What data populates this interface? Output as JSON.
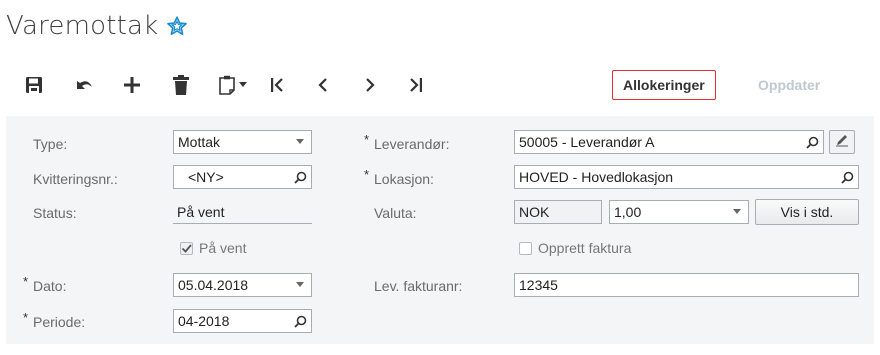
{
  "page": {
    "title": "Varemottak",
    "favorite_icon": "star-outline-icon",
    "accent": "#1a8ad4"
  },
  "toolbar": {
    "icons": [
      "save-icon",
      "undo-icon",
      "add-icon",
      "delete-icon",
      "paste-icon",
      "dropdown-caret-icon",
      "first-icon",
      "previous-icon",
      "next-icon",
      "last-icon"
    ],
    "allokeringer_label": "Allokeringer",
    "oppdater_label": "Oppdater",
    "highlight_color": "#e3312e"
  },
  "form": {
    "type": {
      "label": "Type:",
      "value": "Mottak"
    },
    "kvittering": {
      "label": "Kvitteringsnr.:",
      "value": "<NY>"
    },
    "status": {
      "label": "Status:",
      "value": "På vent"
    },
    "paa_vent": {
      "label": "På vent",
      "checked": true
    },
    "dato": {
      "label": "Dato:",
      "value": "05.04.2018",
      "required_mark": "*"
    },
    "periode": {
      "label": "Periode:",
      "value": "04-2018",
      "required_mark": "*"
    },
    "leverandor": {
      "label": "Leverandør:",
      "value": "50005 - Leverandør A",
      "required_mark": "*"
    },
    "lokasjon": {
      "label": "Lokasjon:",
      "value": "HOVED - Hovedlokasjon",
      "required_mark": "*"
    },
    "valuta": {
      "label": "Valuta:",
      "currency": "NOK",
      "rate": "1,00",
      "button": "Vis i std."
    },
    "opprett_faktura": {
      "label": "Opprett faktura",
      "checked": false
    },
    "lev_fakturanr": {
      "label": "Lev. fakturanr:",
      "value": "12345"
    }
  }
}
